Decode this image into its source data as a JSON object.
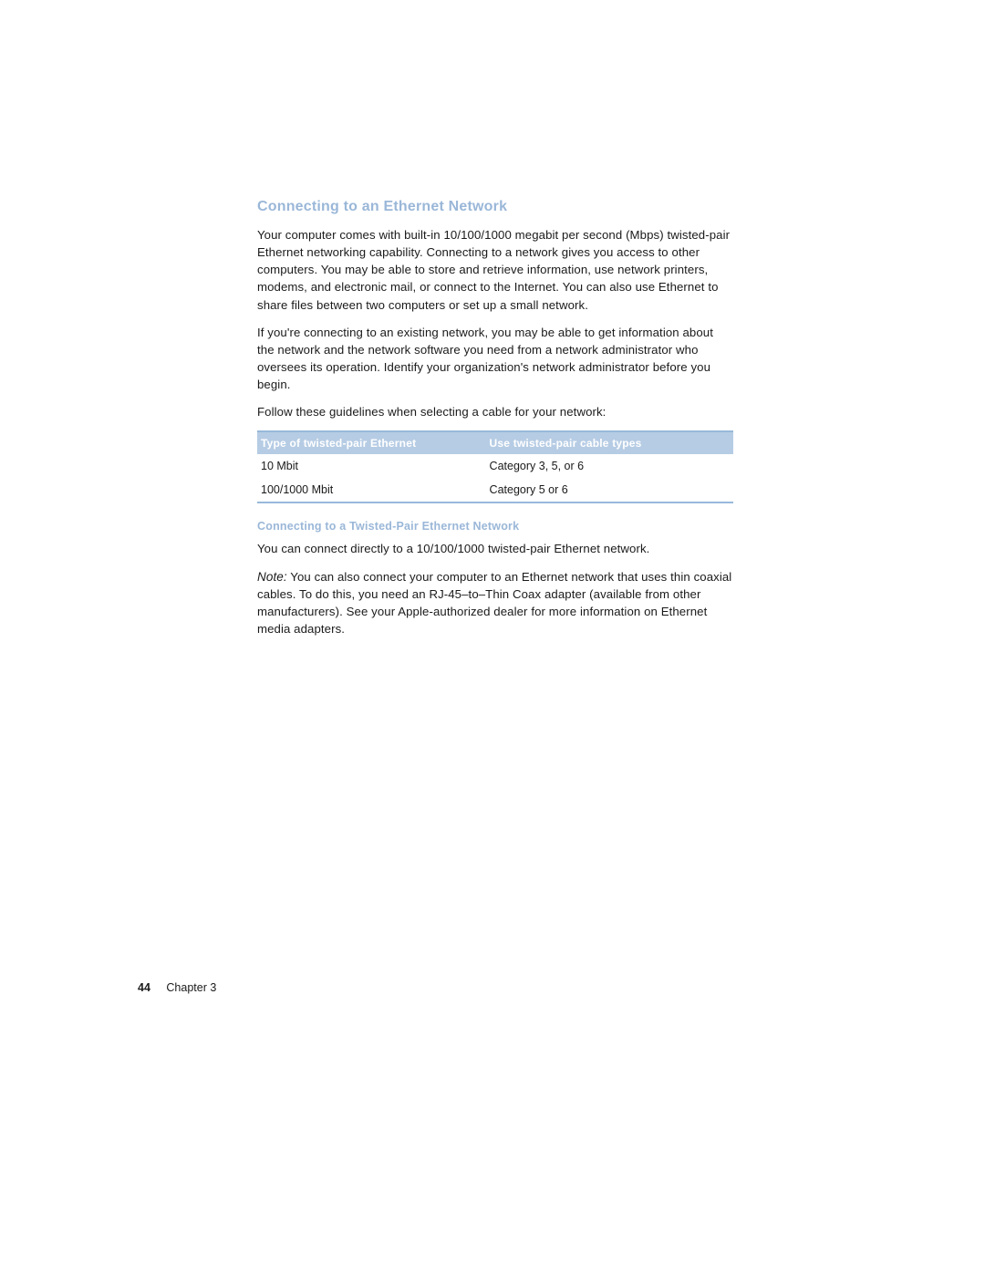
{
  "heading": "Connecting to an Ethernet Network",
  "para1": "Your computer comes with built-in 10/100/1000 megabit per second (Mbps) twisted-pair Ethernet networking capability. Connecting to a network gives you access to other computers. You may be able to store and retrieve information, use network printers, modems, and electronic mail, or connect to the Internet. You can also use Ethernet to share files between two computers or set up a small network.",
  "para2": "If you're connecting to an existing network, you may be able to get information about the network and the network software you need from a network administrator who oversees its operation. Identify your organization's network administrator before you begin.",
  "para3": "Follow these guidelines when selecting a cable for your network:",
  "table": {
    "head1": "Type of twisted-pair Ethernet",
    "head2": "Use twisted-pair cable types",
    "rows": [
      {
        "c1": "10 Mbit",
        "c2": "Category 3, 5, or 6"
      },
      {
        "c1": "100/1000 Mbit",
        "c2": "Category 5 or 6"
      }
    ]
  },
  "subheading": "Connecting to a Twisted-Pair Ethernet Network",
  "para4": "You can connect directly to a 10/100/1000 twisted-pair Ethernet network.",
  "noteLabel": "Note:",
  "noteText": "  You can also connect your computer to an Ethernet network that uses thin coaxial cables. To do this, you need an RJ-45–to–Thin Coax adapter (available from other manufacturers). See your Apple-authorized dealer for more information on Ethernet media adapters.",
  "footer": {
    "page": "44",
    "chapter": "Chapter 3"
  }
}
